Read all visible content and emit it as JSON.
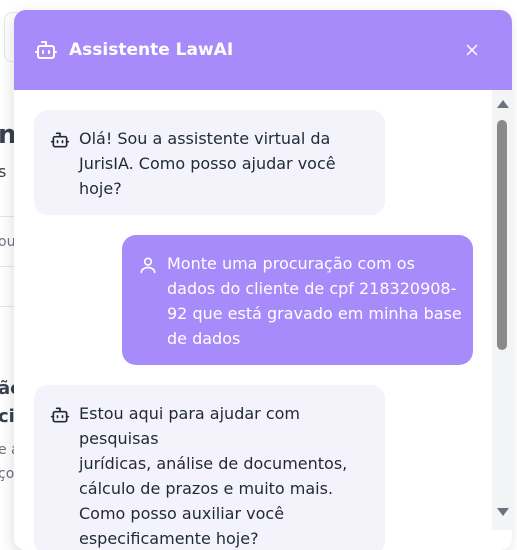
{
  "background": {
    "fragments": [
      "n'",
      "s",
      "ou",
      "ãc",
      "cia",
      "e a",
      "ço"
    ]
  },
  "header": {
    "title": "Assistente LawAI",
    "icon": "bot-icon",
    "close_icon": "close-icon",
    "background_color": "#a78bfa"
  },
  "messages": [
    {
      "role": "bot",
      "icon": "bot-icon",
      "lines": [
        "Olá! Sou a assistente virtual da",
        "JurisIA. Como posso ajudar você",
        "hoje?"
      ]
    },
    {
      "role": "user",
      "icon": "user-icon",
      "lines": [
        "Monte uma procuração com os",
        "dados do cliente de cpf 218320908-",
        "92 que está gravado em minha base",
        "de dados"
      ]
    },
    {
      "role": "bot",
      "icon": "bot-icon",
      "lines": [
        "Estou aqui para ajudar com pesquisas",
        "jurídicas, análise de documentos,",
        "cálculo de prazos e muito mais.",
        "Como posso auxiliar você",
        "especificamente hoje?"
      ]
    }
  ],
  "colors": {
    "accent": "#a78bfa",
    "bot_bubble": "#f4f3fb"
  }
}
